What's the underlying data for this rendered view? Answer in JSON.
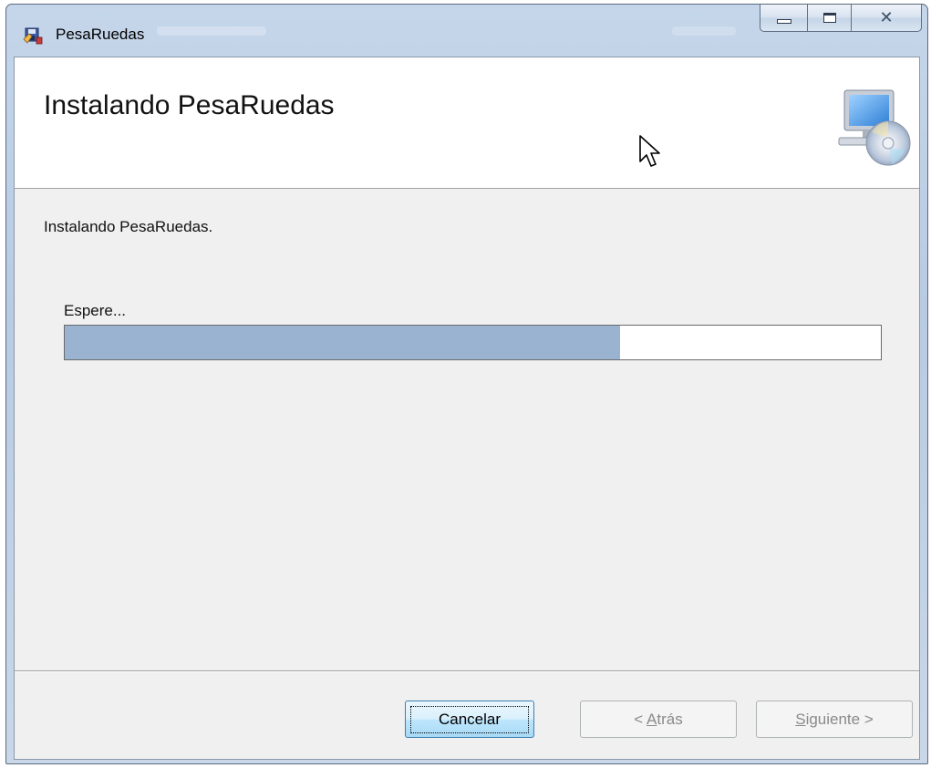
{
  "window": {
    "title": "PesaRuedas"
  },
  "banner": {
    "title": "Instalando PesaRuedas"
  },
  "main": {
    "status": "Instalando PesaRuedas.",
    "wait_label": "Espere...",
    "progress_fraction": 0.68
  },
  "buttons": {
    "cancel": "Cancelar",
    "back_prefix": "< ",
    "back_mnemonic": "A",
    "back_rest": "trás",
    "next_mnemonic": "S",
    "next_rest": "iguiente >"
  },
  "icons": {
    "app": "installer-icon",
    "banner": "computer-cd-icon",
    "minimize": "minimize-icon",
    "maximize": "maximize-icon",
    "close": "close-icon",
    "cursor": "mouse-cursor-icon"
  },
  "colors": {
    "progress_fill": "#9ab3d1",
    "client_bg": "#f0f0f0"
  }
}
